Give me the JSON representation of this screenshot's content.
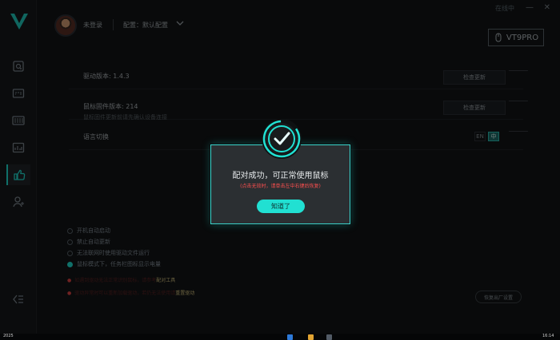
{
  "app": {
    "logo": "v-logo",
    "user": {
      "name": "未登录",
      "config_label": "配置：默认配置"
    },
    "top_status": "在线中",
    "device_name": "VT9PRO",
    "sidebar": [
      {
        "icon": "mouse-settings-icon"
      },
      {
        "icon": "dpi-icon"
      },
      {
        "icon": "keyboard-bars-icon"
      },
      {
        "icon": "chart-icon"
      },
      {
        "icon": "thumbs-up-icon"
      },
      {
        "icon": "user-add-icon"
      }
    ],
    "rows": [
      {
        "label": "驱动版本: 1.4.3",
        "button": "检查更新"
      },
      {
        "label": "鼠标固件版本: 214",
        "sub": "鼠标固件更新前请先确认设备连接",
        "button": "检查更新"
      },
      {
        "label": "语言切换",
        "toggle": [
          "EN",
          "中"
        ]
      }
    ],
    "options": [
      {
        "label": "开机自动启动",
        "selected": false
      },
      {
        "label": "禁止自动更新",
        "selected": false
      },
      {
        "label": "无法联网时使用驱动文件运行",
        "selected": false
      },
      {
        "label": "鼠标模式下，任务栏图标显示电量",
        "selected": true
      }
    ],
    "notes": [
      {
        "text": "如遇到驱动无法正常识别鼠标，请参考",
        "link": "配对工具"
      },
      {
        "text": "驱动异常时可以重新加载驱动，若仍无法使用请",
        "link": "重置驱动"
      }
    ],
    "restore_button": "恢复出厂设置"
  },
  "modal": {
    "title": "配对成功，可正常使用鼠标",
    "tip": "(点击无效时，请单击左中右键后恢复)",
    "ok": "知道了",
    "icon": "check-circle-icon",
    "accent": "#21e0d2"
  },
  "taskbar": {
    "left_text": "2025",
    "right_text": "16:14"
  }
}
